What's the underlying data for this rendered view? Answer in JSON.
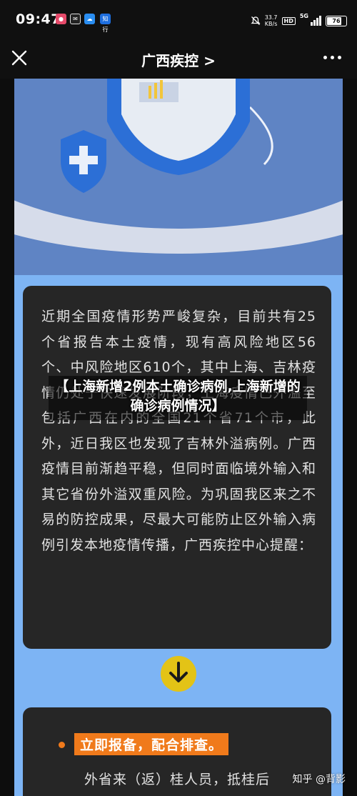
{
  "status_bar": {
    "time": "09:47",
    "notif_icons": [
      "app-icon-1",
      "app-icon-2",
      "app-icon-3"
    ],
    "notif_badge_text": "知行",
    "net_speed_value": "33.7",
    "net_speed_unit": "KB/s",
    "hd_label": "HD",
    "network_label": "5G",
    "battery_level": "76"
  },
  "nav": {
    "title": "广西疾控 >",
    "close_icon": "close-icon",
    "more_icon": "more-icon"
  },
  "article": {
    "intro_paragraph": "近期全国疫情形势严峻复杂，目前共有25个省报告本土疫情，现有高风险地区56个、中风险地区610个，其中上海、吉林疫情仍处于快速发展阶段，上海疫情已外溢至包括广西在内的全国21个省71个市，此外，近日我区也发现了吉林外溢病例。广西疫情目前渐趋平稳，但同时面临境外输入和其它省份外溢双重风险。为巩固我区来之不易的防控成果，尽最大可能防止区外输入病例引发本地疫情传播，广西疾控中心提醒：",
    "divider_icon": "arrow-down-icon",
    "section_label": "立即报备，配合排查。",
    "section_next_line": "外省来（返）桂人员，抵桂后"
  },
  "overlay_caption": "【上海新增2例本土确诊病例,上海新增的确诊病例情况】",
  "watermark": "知乎 @背影",
  "colors": {
    "page_bg": "#0d0d0d",
    "content_bg": "#7db4f4",
    "card_bg": "#262626",
    "accent_orange": "#f07a1b",
    "accent_yellow": "#e3c316"
  }
}
